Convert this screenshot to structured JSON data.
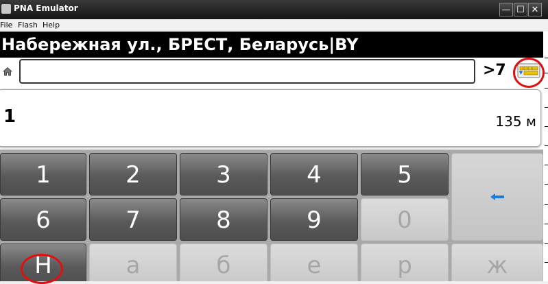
{
  "window": {
    "title": "PNA Emulator",
    "minimize": "—",
    "maximize": "☐",
    "close": "✕"
  },
  "menu": [
    "File",
    "Flash",
    "Help"
  ],
  "header": {
    "address": "Набережная ул., БРЕСТ, Беларусь|BY"
  },
  "search": {
    "value": "",
    "placeholder": ""
  },
  "results_count": ">7",
  "result": {
    "number": "1",
    "distance": "135 м"
  },
  "keyboard": {
    "row1": [
      "1",
      "2",
      "3",
      "4",
      "5"
    ],
    "row2": [
      "6",
      "7",
      "8",
      "9",
      "0"
    ],
    "row3": [
      "Н",
      "а",
      "б",
      "е",
      "р",
      "ж"
    ],
    "backspace_icon": "arrow-left-icon"
  },
  "colors": {
    "annotation": "#e01010",
    "header_bg": "#000000",
    "back_arrow": "#1a7ee0"
  }
}
